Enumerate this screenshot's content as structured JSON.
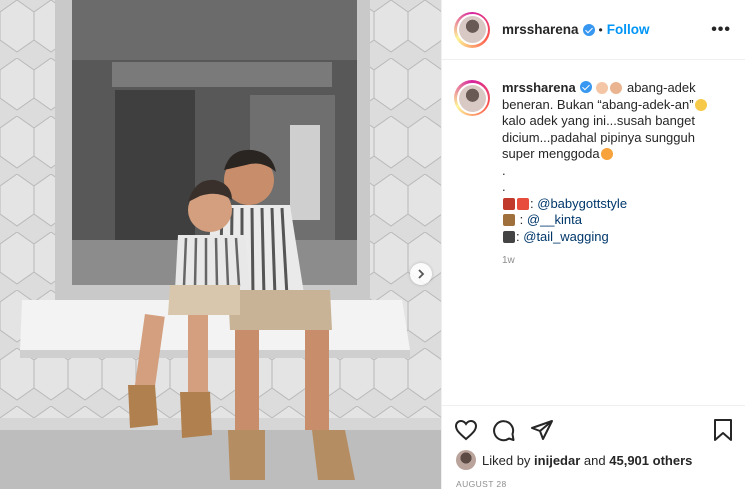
{
  "post": {
    "username": "mrssharena",
    "follow_label": "Follow",
    "separator": "•",
    "more_label": "•••"
  },
  "caption": {
    "username": "mrssharena",
    "line1": "abang-adek",
    "line2": "beneran. Bukan “abang-adek-an”",
    "line3": "kalo adek yang ini...susah banget",
    "line4": "dicium...padahal pipinya sungguh",
    "line5": "super menggoda",
    "dot1": ".",
    "dot2": ".",
    "credit1_sep": ":",
    "credit1": "@babygottstyle",
    "credit2_sep": ":",
    "credit2": "@__kinta",
    "credit3_sep": ":",
    "credit3": "@tail_wagging",
    "time": "1w"
  },
  "likes": {
    "prefix": "Liked by",
    "user": "inijedar",
    "and": "and",
    "count": "45,901 others"
  },
  "date": "AUGUST 28",
  "colors": {
    "accent": "#0095f6",
    "verified": "#3897f0",
    "muted": "#8e8e8e"
  }
}
